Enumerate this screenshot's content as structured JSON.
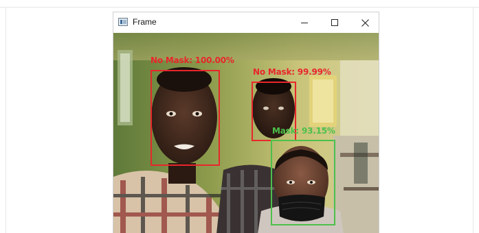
{
  "window": {
    "title": "Frame",
    "icon": "app-window-icon",
    "controls": [
      "minimize-icon",
      "maximize-icon",
      "close-icon"
    ]
  },
  "detections": [
    {
      "label": "No Mask: 100.00%",
      "status": "no-mask",
      "color": "#e8262c"
    },
    {
      "label": "No Mask: 99.99%",
      "status": "no-mask",
      "color": "#e8262c"
    },
    {
      "label": "Mask: 93.15%",
      "status": "mask",
      "color": "#4cc04a"
    }
  ]
}
